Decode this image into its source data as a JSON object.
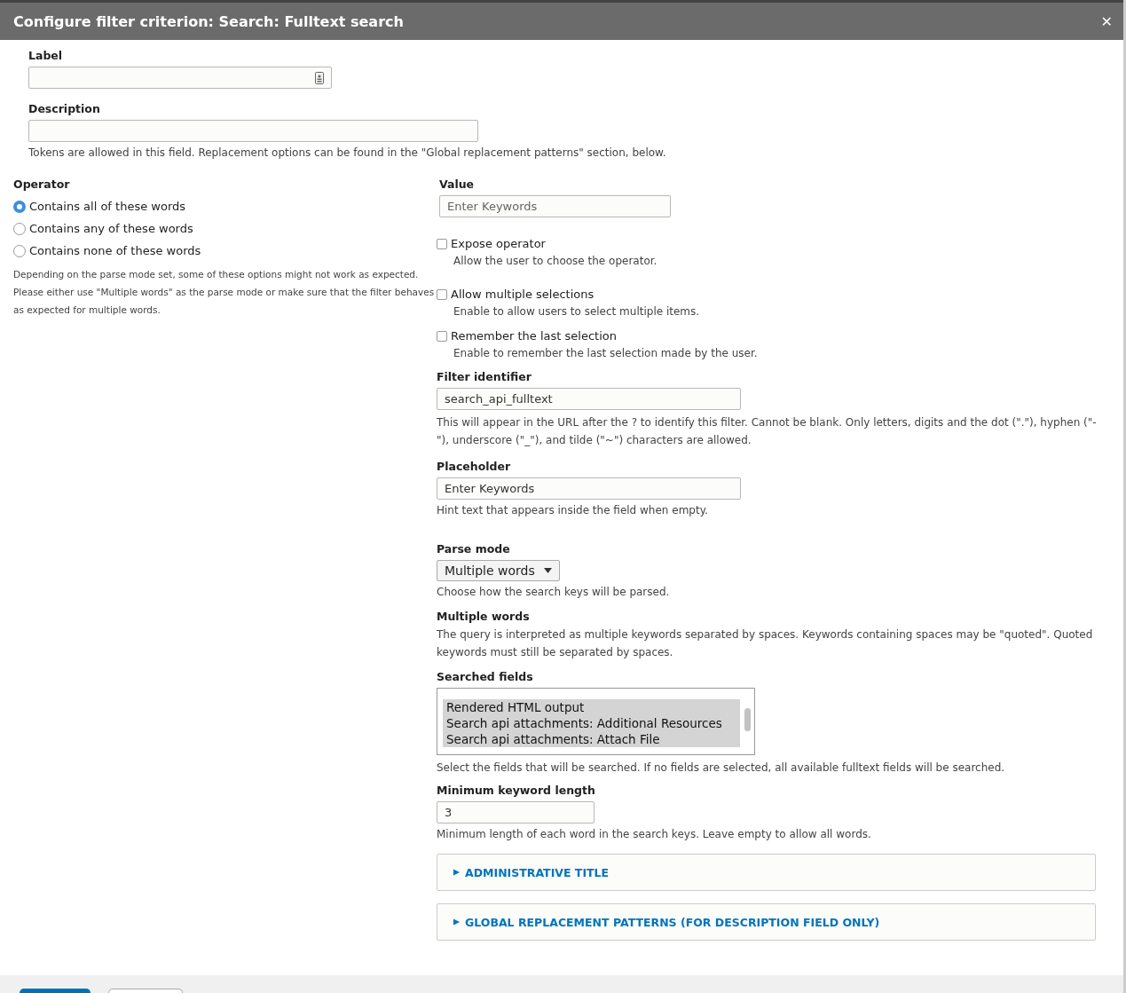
{
  "dialog": {
    "title": "Configure filter criterion: Search: Fulltext search",
    "close": "✕"
  },
  "label_field": {
    "label": "Label"
  },
  "description_field": {
    "label": "Description",
    "help": "Tokens are allowed in this field. Replacement options can be found in the \"Global replacement patterns\" section, below."
  },
  "operator": {
    "label": "Operator",
    "options": [
      {
        "label": "Contains all of these words",
        "selected": true
      },
      {
        "label": "Contains any of these words",
        "selected": false
      },
      {
        "label": "Contains none of these words",
        "selected": false
      }
    ],
    "help": "Depending on the parse mode set, some of these options might not work as expected. Please either use \"Multiple words\" as the parse mode or make sure that the filter behaves as expected for multiple words."
  },
  "value": {
    "label": "Value",
    "placeholder": "Enter Keywords"
  },
  "checkboxes": [
    {
      "label": "Expose operator",
      "help": "Allow the user to choose the operator.",
      "checked": false
    },
    {
      "label": "Allow multiple selections",
      "help": "Enable to allow users to select multiple items.",
      "checked": false
    },
    {
      "label": "Remember the last selection",
      "help": "Enable to remember the last selection made by the user.",
      "checked": false
    }
  ],
  "filter_identifier": {
    "label": "Filter identifier",
    "value": "search_api_fulltext",
    "help": "This will appear in the URL after the ? to identify this filter. Cannot be blank. Only letters, digits and the dot (\".\"), hyphen (\"-\"), underscore (\"_\"), and tilde (\"~\") characters are allowed."
  },
  "placeholder_field": {
    "label": "Placeholder",
    "value": "Enter Keywords",
    "help": "Hint text that appears inside the field when empty."
  },
  "parse_mode": {
    "label": "Parse mode",
    "value": "Multiple words",
    "help": "Choose how the search keys will be parsed."
  },
  "multiple_words": {
    "heading": "Multiple words",
    "text": "The query is interpreted as multiple keywords separated by spaces. Keywords containing spaces may be \"quoted\". Quoted keywords must still be separated by spaces."
  },
  "searched_fields": {
    "label": "Searched fields",
    "options": [
      {
        "label": "Rendered HTML output",
        "selected": true
      },
      {
        "label": "Search api attachments: Additional Resources",
        "selected": true
      },
      {
        "label": "Search api attachments: Attach File",
        "selected": true
      }
    ],
    "help": "Select the fields that will be searched. If no fields are selected, all available fulltext fields will be searched."
  },
  "min_keyword_length": {
    "label": "Minimum keyword length",
    "value": "3",
    "help": "Minimum length of each word in the search keys. Leave empty to allow all words."
  },
  "details": [
    {
      "title": "ADMINISTRATIVE TITLE",
      "expanded": false
    },
    {
      "title": "GLOBAL REPLACEMENT PATTERNS (FOR DESCRIPTION FIELD ONLY)",
      "expanded": false
    }
  ],
  "footer": {
    "buttons": [
      {
        "kind": "primary"
      },
      {
        "kind": "secondary"
      }
    ]
  }
}
